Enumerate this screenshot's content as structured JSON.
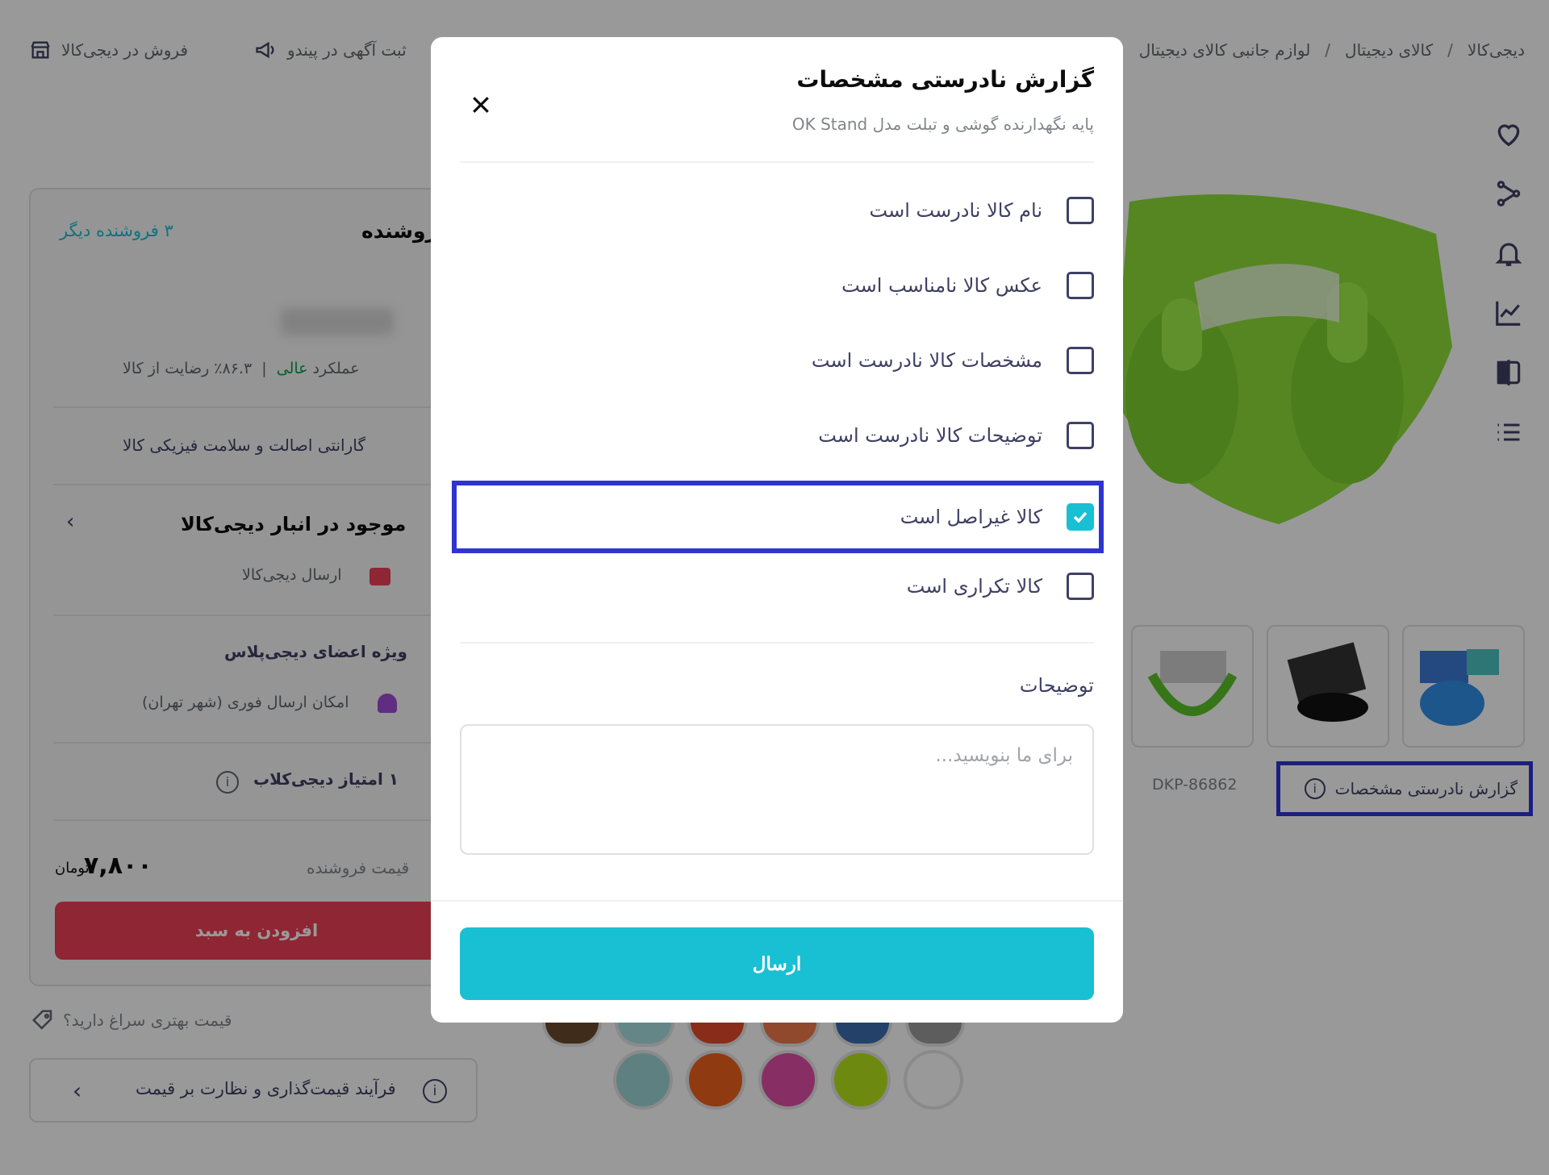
{
  "topbar": {
    "sell_label": "فروش در دیجی‌کالا",
    "ad_label": "ثبت آگهی در پیندو"
  },
  "breadcrumb": [
    "دیجی‌کالا",
    "کالای دیجیتال",
    "لوازم جانبی کالای دیجیتال"
  ],
  "seller_box": {
    "title": "فروشنده",
    "other_sellers": "۳ فروشنده دیگر",
    "satisfaction": "۸۶.۳٪ رضایت از کالا",
    "performance_label": "عملکرد",
    "performance_value": "عالی",
    "guarantee": "گارانتی اصالت و سلامت فیزیکی کالا",
    "stock": "موجود در انبار دیجی‌کالا",
    "shipping": "ارسال دیجی‌کالا",
    "plus": "ویژه اعضای دیجی‌پلاس",
    "fast_delivery": "امکان ارسال فوری (شهر تهران)",
    "club_points": "۱ امتیاز دیجی‌کلاب",
    "price_label": "قیمت فروشنده",
    "price": "۷,۸۰۰",
    "currency": "تومان",
    "add_to_cart": "افزودن به سبد"
  },
  "better_price": "قیمت بهتری سراغ دارید؟",
  "pricing_process": "فرآیند قیمت‌گذاری و نظارت بر قیمت",
  "product_code": "DKP-86862",
  "report_link": "گزارش نادرستی مشخصات",
  "colors": {
    "accent": "#19bfd3",
    "cart": "#ef4056",
    "highlight": "#2f34d0",
    "product": "#8ee03a",
    "swatches_top": [
      "#6b4a2e",
      "#a7dfe0",
      "#e54a2a",
      "#f07a4c",
      "#3c6fb0",
      "#9b9b9b"
    ],
    "swatches": [
      "#9ed6d8",
      "#f0621f",
      "#e24fa8",
      "#b8e51c",
      "#ffffff"
    ]
  },
  "modal": {
    "title": "گزارش نادرستی مشخصات",
    "subtitle": "پایه نگهدارنده گوشی و تبلت مدل OK Stand",
    "options": [
      {
        "label": "نام کالا نادرست است",
        "checked": false
      },
      {
        "label": "عکس کالا نامناسب است",
        "checked": false
      },
      {
        "label": "مشخصات کالا نادرست است",
        "checked": false
      },
      {
        "label": "توضیحات کالا نادرست است",
        "checked": false
      },
      {
        "label": "کالا غیراصل است",
        "checked": true
      },
      {
        "label": "کالا تکراری است",
        "checked": false
      }
    ],
    "description_label": "توضیحات",
    "description_placeholder": "برای ما بنویسید...",
    "submit_label": "ارسال"
  }
}
